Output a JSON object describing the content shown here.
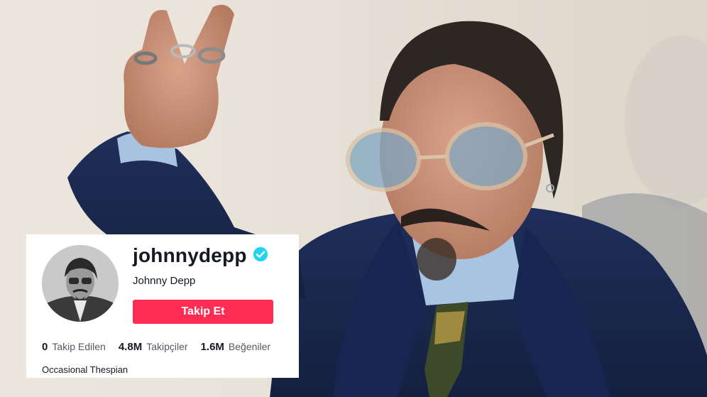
{
  "profile": {
    "username": "johnnydepp",
    "display_name": "Johnny Depp",
    "follow_label": "Takip Et",
    "bio": "Occasional Thespian",
    "verified_icon": "verified-badge-icon",
    "stats": [
      {
        "value": "0",
        "label": "Takip Edilen"
      },
      {
        "value": "4.8M",
        "label": "Takipçiler"
      },
      {
        "value": "1.6M",
        "label": "Beğeniler"
      }
    ]
  },
  "colors": {
    "follow_button": "#fe2c55",
    "verified_badge": "#20d5ec",
    "text_primary": "#161823",
    "text_secondary": "#555860"
  }
}
